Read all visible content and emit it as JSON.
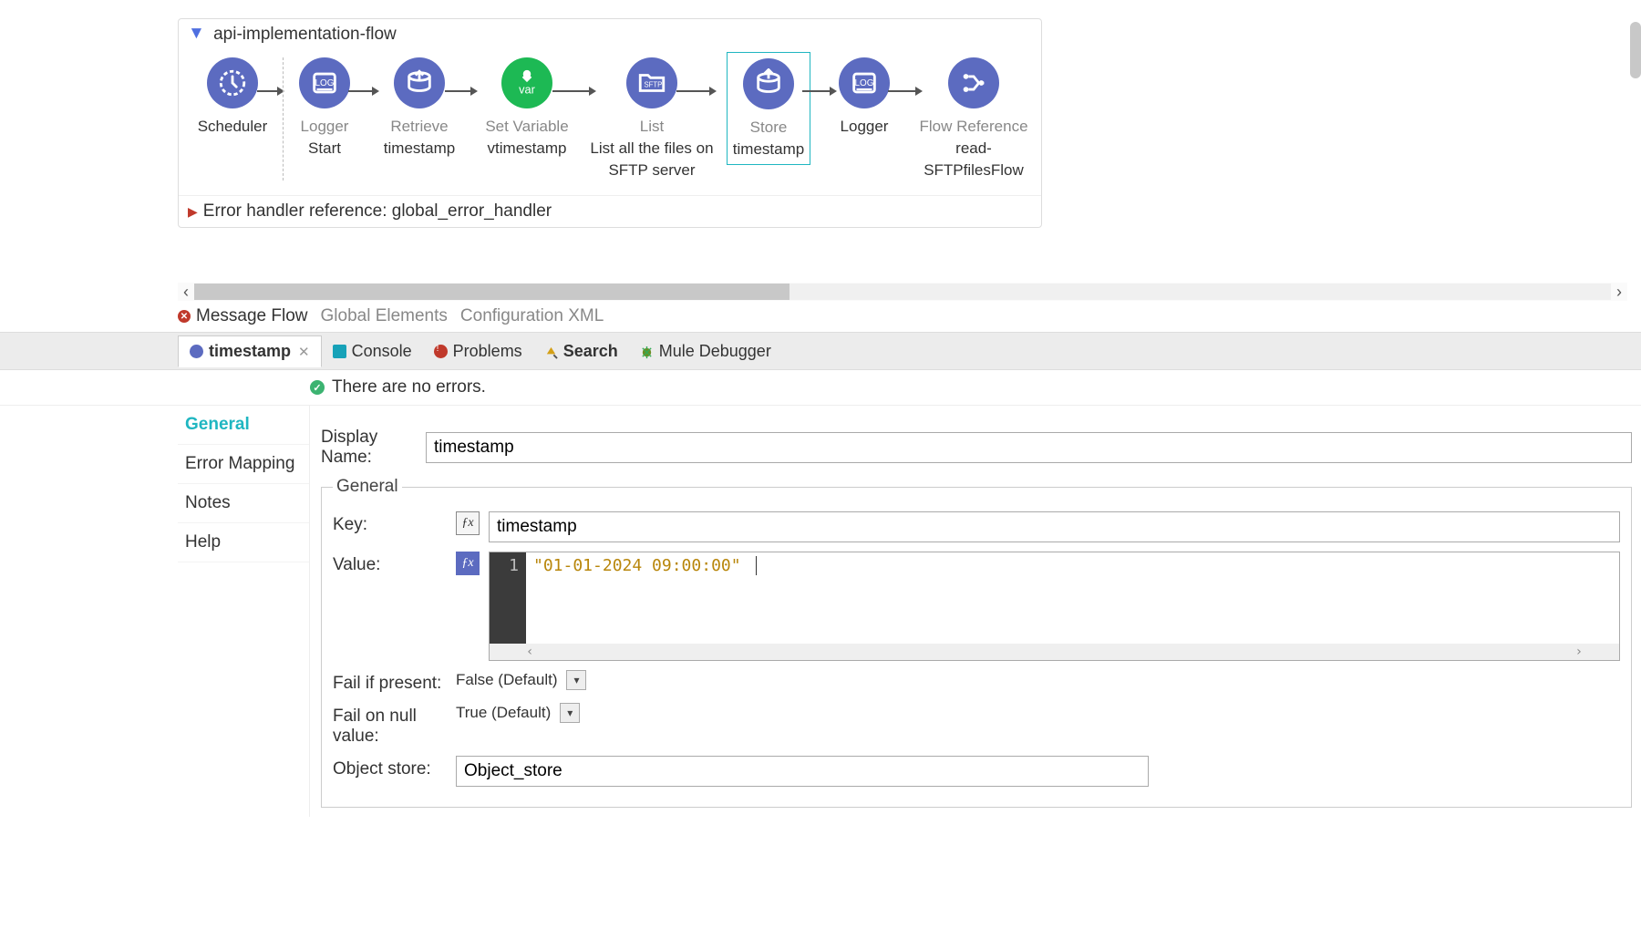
{
  "flow": {
    "name": "api-implementation-flow",
    "error_handler_label": "Error handler reference: global_error_handler",
    "nodes": [
      {
        "title": "Scheduler",
        "sub": ""
      },
      {
        "title": "Logger",
        "sub": "Start"
      },
      {
        "title": "Retrieve",
        "sub": "timestamp"
      },
      {
        "title": "Set Variable",
        "sub": "vtimestamp"
      },
      {
        "title": "List",
        "sub": "List all the files on SFTP server"
      },
      {
        "title": "Store",
        "sub": "timestamp"
      },
      {
        "title": "Logger",
        "sub": ""
      },
      {
        "title": "Flow Reference",
        "sub": "read-SFTPfilesFlow"
      }
    ]
  },
  "editor_tabs": {
    "message_flow": "Message Flow",
    "global_elements": "Global Elements",
    "config_xml": "Configuration XML"
  },
  "lower_tabs": {
    "timestamp": "timestamp",
    "console": "Console",
    "problems": "Problems",
    "search": "Search",
    "mule_debugger": "Mule Debugger"
  },
  "status": {
    "message": "There are no errors."
  },
  "side": {
    "general": "General",
    "error_mapping": "Error Mapping",
    "notes": "Notes",
    "help": "Help"
  },
  "form": {
    "display_name_label": "Display Name:",
    "display_name_value": "timestamp",
    "fieldset_legend": "General",
    "key_label": "Key:",
    "key_value": "timestamp",
    "value_label": "Value:",
    "value_line_no": "1",
    "value_code": "\"01-01-2024 09:00:00\"",
    "fail_if_present_label": "Fail if present:",
    "fail_if_present_value": "False (Default)",
    "fail_on_null_label": "Fail on null value:",
    "fail_on_null_value": "True (Default)",
    "object_store_label": "Object store:",
    "object_store_value": "Object_store"
  }
}
